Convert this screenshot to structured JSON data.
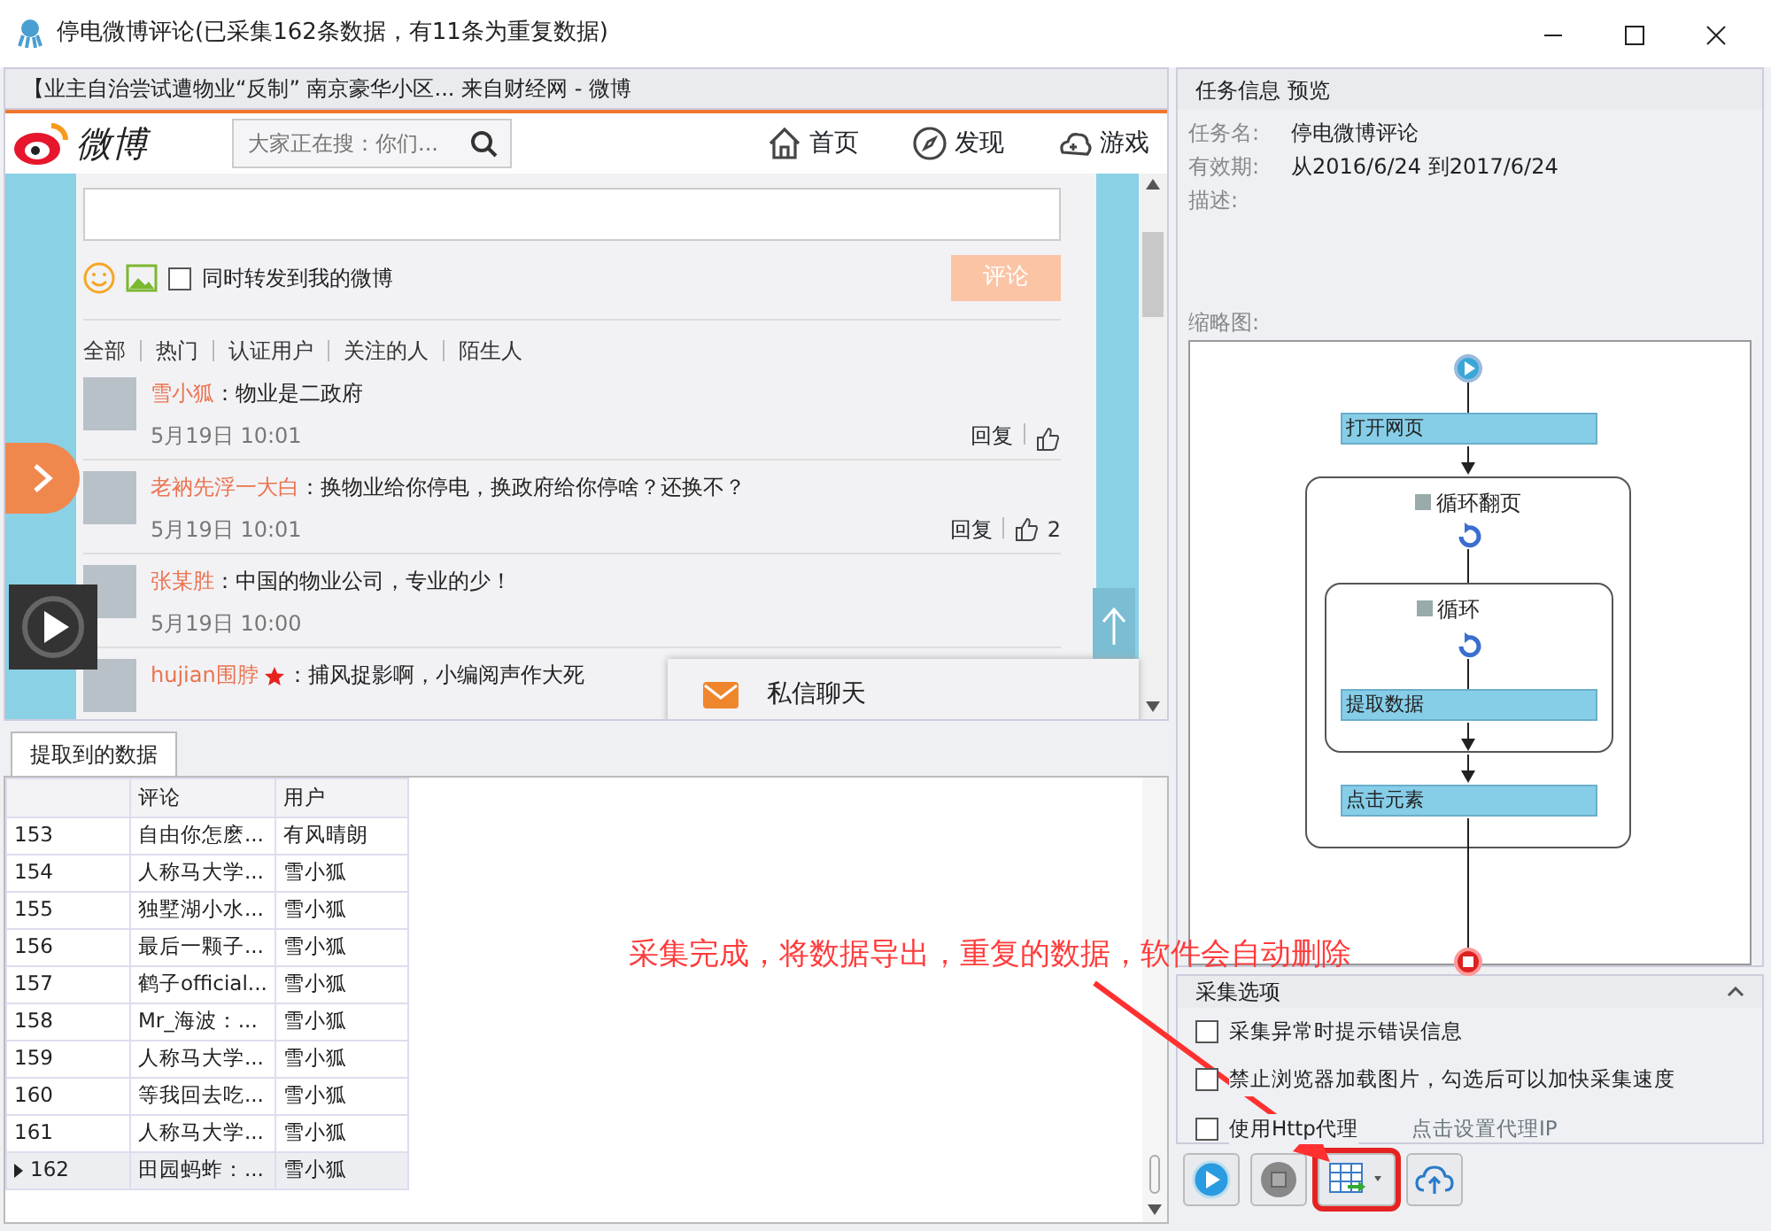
{
  "window": {
    "title": "停电微博评论(已采集162条数据，有11条为重复数据)"
  },
  "browser": {
    "page_title": "【业主自治尝试遭物业“反制” 南京豪华小区... 来自财经网 - 微博",
    "logo_text": "微博",
    "search": {
      "placeholder": "大家正在搜：你们..."
    },
    "nav": [
      {
        "label": "首页",
        "kind": "home"
      },
      {
        "label": "发现",
        "kind": "discover"
      },
      {
        "label": "游戏",
        "kind": "game"
      }
    ],
    "repost_checkbox": {
      "label": "同时转发到我的微博",
      "checked": false
    },
    "submit_button": "评论",
    "filters": [
      "全部",
      "热门",
      "认证用户",
      "关注的人",
      "陌生人"
    ],
    "comments": [
      {
        "user": "雪小狐",
        "text": "：物业是二政府",
        "time": "5月19日 10:01",
        "reply": "回复"
      },
      {
        "user": "老衲先浮一大白",
        "text": "：换物业给你停电，换政府给你停啥？还换不？",
        "time": "5月19日 10:01",
        "reply": "回复",
        "likes": "2"
      },
      {
        "user": "张某胜",
        "text": "：中国的物业公司，专业的少！",
        "time": "5月19日 10:00"
      },
      {
        "user": "hujian围脖",
        "text": "：捕风捉影啊，小编阅声作大死",
        "starred": true
      }
    ],
    "popup": {
      "label": "私信聊天"
    }
  },
  "data_panel": {
    "tab": "提取到的数据",
    "columns": [
      "评论",
      "用户"
    ],
    "rows": [
      {
        "index": "153",
        "comment": "自由你怎麽...",
        "user": "有风晴朗",
        "selected": false
      },
      {
        "index": "154",
        "comment": "人称马大学...",
        "user": "雪小狐",
        "selected": false
      },
      {
        "index": "155",
        "comment": "独墅湖小水...",
        "user": "雪小狐",
        "selected": false
      },
      {
        "index": "156",
        "comment": "最后一颗子...",
        "user": "雪小狐",
        "selected": false
      },
      {
        "index": "157",
        "comment": "鹤子official...",
        "user": "雪小狐",
        "selected": false
      },
      {
        "index": "158",
        "comment": "Mr_海波：...",
        "user": "雪小狐",
        "selected": false
      },
      {
        "index": "159",
        "comment": "人称马大学...",
        "user": "雪小狐",
        "selected": false
      },
      {
        "index": "160",
        "comment": "等我回去吃...",
        "user": "雪小狐",
        "selected": false
      },
      {
        "index": "161",
        "comment": "人称马大学...",
        "user": "雪小狐",
        "selected": false
      },
      {
        "index": "162",
        "comment": "田园蚂蚱：...",
        "user": "雪小狐",
        "selected": true
      }
    ]
  },
  "task_info": {
    "title": "任务信息 预览",
    "fields": [
      {
        "label": "任务名:",
        "value": "停电微博评论"
      },
      {
        "label": "有效期:",
        "value": "从2016/6/24 到2017/6/24"
      },
      {
        "label": "描述:"
      }
    ],
    "thumbnail_label": "缩略图:",
    "flow": [
      {
        "kind": "step",
        "label": "打开网页"
      },
      {
        "kind": "loop",
        "label": "循环翻页"
      },
      {
        "kind": "loop",
        "label": "循环"
      },
      {
        "kind": "step",
        "label": "提取数据"
      },
      {
        "kind": "step",
        "label": "点击元素"
      }
    ]
  },
  "options": {
    "title": "采集选项",
    "items": [
      {
        "label": "采集异常时提示错误信息",
        "checked": false
      },
      {
        "label": "禁止浏览器加载图片，勾选后可以加快采集速度",
        "checked": false
      },
      {
        "label": "使用Http代理",
        "checked": false,
        "link": "点击设置代理IP"
      }
    ]
  },
  "toolbar": [
    {
      "kind": "start",
      "highlighted": false
    },
    {
      "kind": "stop",
      "highlighted": false
    },
    {
      "kind": "export",
      "highlighted": true
    },
    {
      "kind": "cloud",
      "highlighted": false
    }
  ],
  "annotation": {
    "text": "采集完成，将数据导出，重复的数据，软件会自动删除"
  }
}
